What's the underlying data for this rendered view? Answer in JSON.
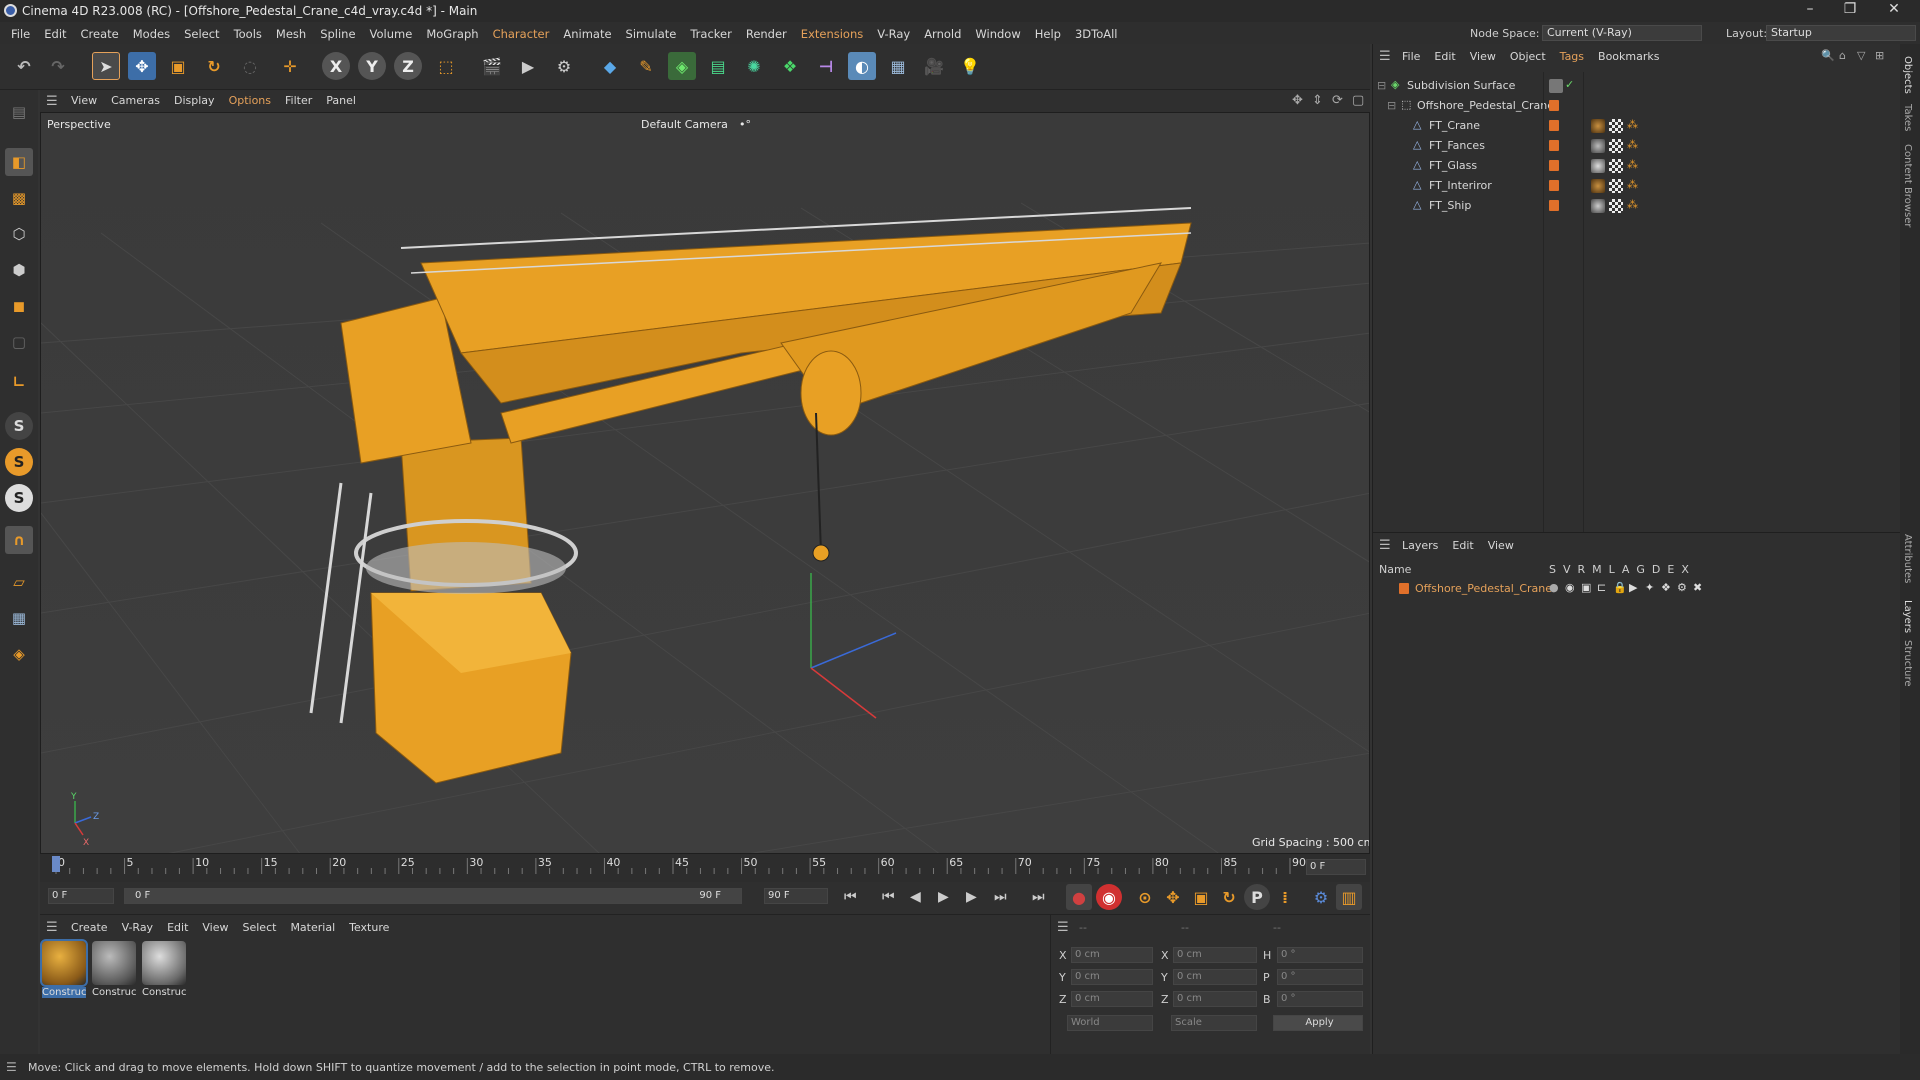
{
  "window": {
    "title": "Cinema 4D R23.008 (RC) - [Offshore_Pedestal_Crane_c4d_vray.c4d *] - Main",
    "controls": [
      "–",
      "❐",
      "✕"
    ]
  },
  "menubar": [
    "File",
    "Edit",
    "Create",
    "Modes",
    "Select",
    "Tools",
    "Mesh",
    "Spline",
    "Volume",
    "MoGraph",
    "Character",
    "Animate",
    "Simulate",
    "Tracker",
    "Render",
    "Extensions",
    "V-Ray",
    "Arnold",
    "Window",
    "Help",
    "3DToAll"
  ],
  "nodespace": {
    "label": "Node Space:",
    "value": "Current (V-Ray)"
  },
  "layout": {
    "label": "Layout:",
    "value": "Startup"
  },
  "viewport": {
    "menu": [
      "View",
      "Cameras",
      "Display",
      "Options",
      "Filter",
      "Panel"
    ],
    "name": "Perspective",
    "camera": "Default Camera",
    "camera_icon": "•°",
    "grid_spacing": "Grid Spacing : 500 cm",
    "axis_y": "Y",
    "axis_z": "Z",
    "axis_x": "X"
  },
  "timeline": {
    "ticks": [
      "0",
      "5",
      "10",
      "15",
      "20",
      "25",
      "30",
      "35",
      "40",
      "45",
      "50",
      "55",
      "60",
      "65",
      "70",
      "75",
      "80",
      "85",
      "90"
    ],
    "end_field": "0 F",
    "start_frame": "0 F",
    "current_frame": "0 F",
    "range_end": "90 F",
    "max_frame": "90 F"
  },
  "objects": {
    "menu": [
      "File",
      "Edit",
      "View",
      "Object",
      "Tags",
      "Bookmarks"
    ],
    "items": [
      {
        "name": "Subdivision Surface",
        "indent": 0
      },
      {
        "name": "Offshore_Pedestal_Crane",
        "indent": 1
      },
      {
        "name": "FT_Crane",
        "indent": 2
      },
      {
        "name": "FT_Fances",
        "indent": 2
      },
      {
        "name": "FT_Glass",
        "indent": 2
      },
      {
        "name": "FT_Interiror",
        "indent": 2
      },
      {
        "name": "FT_Ship",
        "indent": 2
      }
    ]
  },
  "layers": {
    "menu": [
      "Layers",
      "Edit",
      "View"
    ],
    "header_name": "Name",
    "flags": [
      "S",
      "V",
      "R",
      "M",
      "L",
      "A",
      "G",
      "D",
      "E",
      "X"
    ],
    "items": [
      {
        "name": "Offshore_Pedestal_Crane",
        "color": "#e0702a"
      }
    ]
  },
  "materials": {
    "menu": [
      "Create",
      "V-Ray",
      "Edit",
      "View",
      "Select",
      "Material",
      "Texture"
    ],
    "items": [
      {
        "name": "Construc"
      },
      {
        "name": "Construc"
      },
      {
        "name": "Construc"
      }
    ]
  },
  "coords": {
    "header": [
      "--",
      "--",
      "--"
    ],
    "rows": [
      {
        "a": "X",
        "v1": "0 cm",
        "b": "X",
        "v2": "0 cm",
        "c": "H",
        "v3": "0 °"
      },
      {
        "a": "Y",
        "v1": "0 cm",
        "b": "Y",
        "v2": "0 cm",
        "c": "P",
        "v3": "0 °"
      },
      {
        "a": "Z",
        "v1": "0 cm",
        "b": "Z",
        "v2": "0 cm",
        "c": "B",
        "v3": "0 °"
      }
    ],
    "space": "World",
    "mode": "Scale",
    "apply": "Apply"
  },
  "sidetabs": [
    "Objects",
    "Takes",
    "Content Browser",
    "Attributes",
    "Layers",
    "Structure"
  ],
  "status": "Move: Click and drag to move elements. Hold down SHIFT to quantize movement / add to the selection in point mode, CTRL to remove.",
  "colors": {
    "accent": "#e5a15a",
    "crane": "#e8a024",
    "selected": "#3d6ea8"
  }
}
